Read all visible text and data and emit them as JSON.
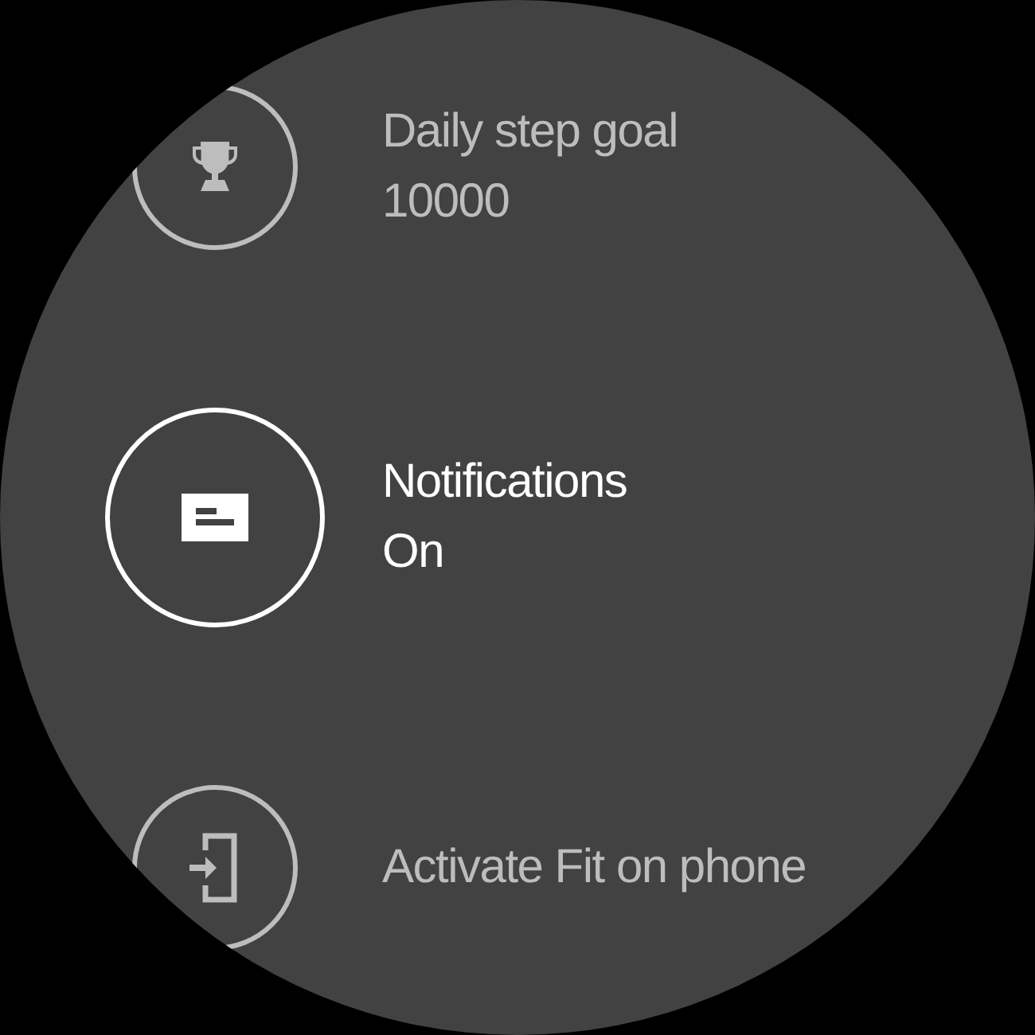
{
  "settings": [
    {
      "kind": "trophy",
      "title": "Daily step goal",
      "value": "10000",
      "selected": false
    },
    {
      "kind": "notifications",
      "title": "Notifications",
      "value": "On",
      "selected": true
    },
    {
      "kind": "phone",
      "title": "Activate Fit on phone",
      "selected": false
    }
  ]
}
